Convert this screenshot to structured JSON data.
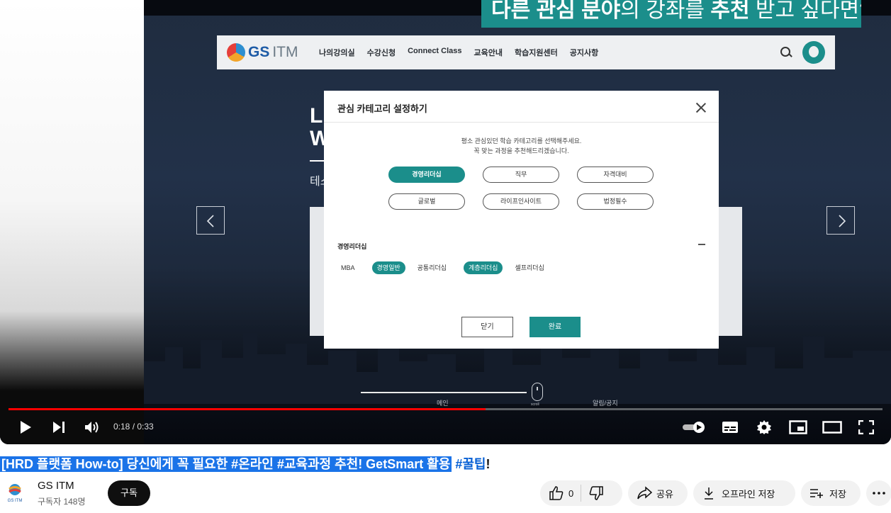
{
  "video": {
    "banner": {
      "pre": "다른 관심 분야",
      "mid": "의 강좌를 ",
      "bold": "추천",
      "post": " 받고 싶다면?"
    },
    "site": {
      "logo_gs": "GS",
      "logo_itm": "ITM",
      "nav": [
        "나의강의실",
        "수강신청",
        "Connect Class",
        "교육안내",
        "학습지원센터",
        "공지사항"
      ],
      "hero_title": "LI\nW",
      "hero_sub": "테스"
    },
    "dialog": {
      "title": "관심 카테고리 설정하기",
      "desc_line1": "평소 관심있던 학습 카테고리를 선택해주세요.",
      "desc_line2": "꼭 맞는 과정을 추천해드리겠습니다.",
      "categories": [
        {
          "label": "경영리더십",
          "selected": true
        },
        {
          "label": "직무",
          "selected": false
        },
        {
          "label": "자격대비",
          "selected": false
        },
        {
          "label": "글로벌",
          "selected": false
        },
        {
          "label": "라이프인사이트",
          "selected": false
        },
        {
          "label": "법정필수",
          "selected": false
        }
      ],
      "subsection_title": "경영리더십",
      "subcategories": [
        {
          "label": "MBA",
          "selected": false
        },
        {
          "label": "경영일반",
          "selected": true
        },
        {
          "label": "공통리더십",
          "selected": false
        },
        {
          "label": "계층리더십",
          "selected": true
        },
        {
          "label": "셀프리더십",
          "selected": false
        }
      ],
      "close_label": "닫기",
      "done_label": "완료"
    },
    "bottom_labels": {
      "main": "메인",
      "scroll": "scroll",
      "notice": "알림/공지"
    }
  },
  "player": {
    "current_time": "0:18",
    "duration": "0:33",
    "progress_fraction": 0.5455,
    "accent_color": "#ff0000"
  },
  "title": {
    "selected_text": "[HRD 플랫폼 How-to] 당신에게 꼭 필요한 #온라인 #교육과정 추천! GetSmart 활용",
    "hashtag": "#꿀팁",
    "suffix": "!"
  },
  "channel": {
    "name": "GS ITM",
    "subscribers": "구독자 148명",
    "subscribe_label": "구독",
    "logo_text": "GS ITM"
  },
  "actions": {
    "like_count": "0",
    "share_label": "공유",
    "download_label": "오프라인 저장",
    "save_label": "저장"
  }
}
